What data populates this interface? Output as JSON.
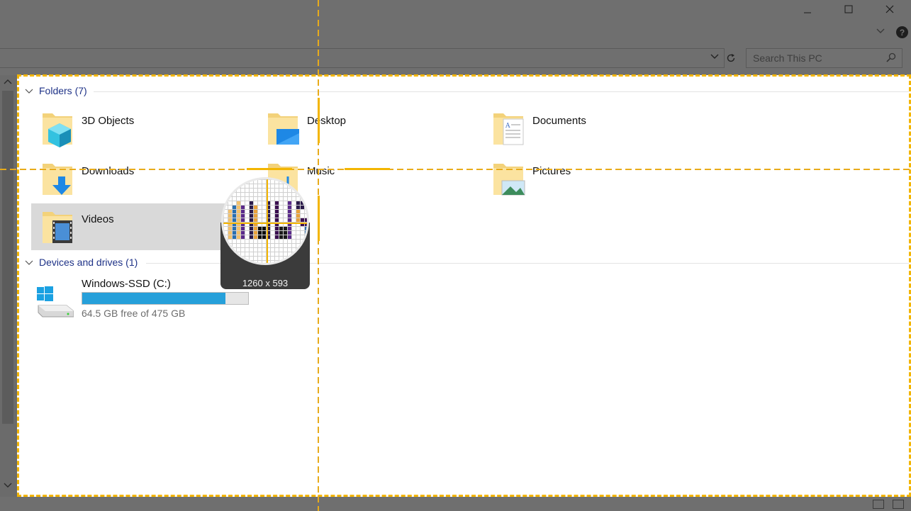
{
  "window": {
    "minimize_icon": "minimize-icon",
    "maximize_icon": "maximize-icon",
    "close_icon": "close-icon",
    "help_label": "?"
  },
  "search": {
    "placeholder": "Search This PC"
  },
  "groups": [
    {
      "label": "Folders (7)"
    },
    {
      "label": "Devices and drives (1)"
    }
  ],
  "folders": [
    {
      "label": "3D Objects",
      "icon": "3d-objects-folder-icon"
    },
    {
      "label": "Desktop",
      "icon": "desktop-folder-icon"
    },
    {
      "label": "Documents",
      "icon": "documents-folder-icon"
    },
    {
      "label": "Downloads",
      "icon": "downloads-folder-icon"
    },
    {
      "label": "Music",
      "icon": "music-folder-icon"
    },
    {
      "label": "Pictures",
      "icon": "pictures-folder-icon"
    },
    {
      "label": "Videos",
      "icon": "videos-folder-icon",
      "selected": true
    }
  ],
  "drives": [
    {
      "label": "Windows-SSD (C:)",
      "free_text": "64.5 GB free of 475 GB",
      "used_fraction": 0.864,
      "icon": "windows-drive-icon"
    }
  ],
  "capture_overlay": {
    "size_readout": "1260 x 593"
  },
  "colors": {
    "accent": "#26a0da",
    "group_header": "#1e3287",
    "capture_border": "#f3b500"
  }
}
